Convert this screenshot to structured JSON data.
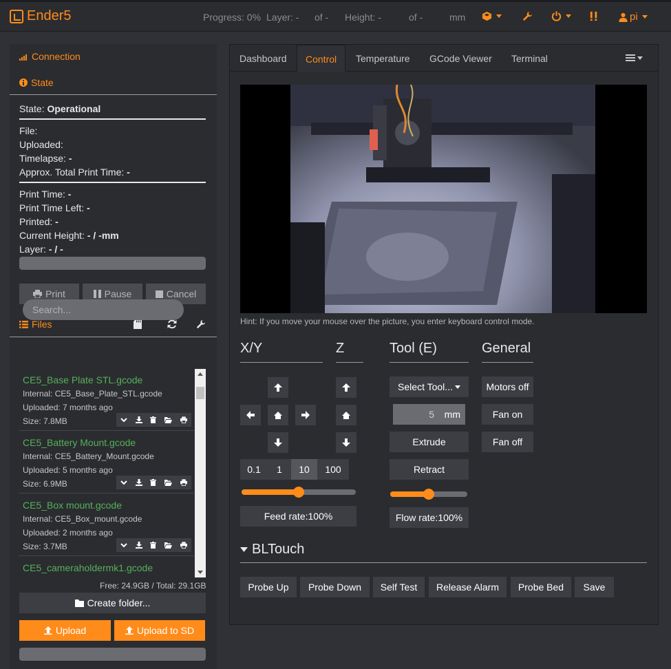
{
  "app": {
    "title": "Ender5",
    "progress": "Progress: 0%",
    "layer_label": "Layer: -",
    "layer_of": "of -",
    "height_label": "Height: -",
    "height_of": "of -",
    "height_unit": "mm",
    "user": "pi"
  },
  "colors": {
    "accent": "#ff8c1a",
    "file_name": "#54b15a",
    "panel": "#2b2c30",
    "background": "#2f3136"
  },
  "sidebar": {
    "connection": "Connection",
    "state": "State",
    "state_label": "State:",
    "state_value": "Operational",
    "file_label": "File:",
    "uploaded_label": "Uploaded:",
    "timelapse_label": "Timelapse:",
    "timelapse_value": "-",
    "approx_label": "Approx. Total Print Time:",
    "approx_value": "-",
    "print_time_label": "Print Time:",
    "print_time_value": "-",
    "print_left_label": "Print Time Left:",
    "print_left_value": "-",
    "printed_label": "Printed:",
    "printed_value": "-",
    "height_label": "Current Height:",
    "height_value": "- / -mm",
    "layer_label": "Layer:",
    "layer_value": "- / -",
    "print_button": "Print",
    "pause_button": "Pause",
    "cancel_button": "Cancel",
    "files": "Files",
    "search_placeholder": "Search...",
    "file_items": [
      {
        "name": "CE5_Base Plate STL.gcode",
        "internal": "Internal: CE5_Base_Plate_STL.gcode",
        "uploaded": "Uploaded: 7 months ago",
        "size": "Size: 7.8MB"
      },
      {
        "name": "CE5_Battery Mount.gcode",
        "internal": "Internal: CE5_Battery_Mount.gcode",
        "uploaded": "Uploaded: 5 months ago",
        "size": "Size: 6.9MB"
      },
      {
        "name": "CE5_Box mount.gcode",
        "internal": "Internal: CE5_Box_mount.gcode",
        "uploaded": "Uploaded: 2 months ago",
        "size": "Size: 3.7MB"
      },
      {
        "name": "CE5_cameraholdermk1.gcode"
      }
    ],
    "free_space": "Free: 24.9GB / Total: 29.1GB",
    "create_folder": "Create folder...",
    "upload": "Upload",
    "upload_sd": "Upload to SD"
  },
  "tabs": [
    "Dashboard",
    "Control",
    "Temperature",
    "GCode Viewer",
    "Terminal"
  ],
  "control": {
    "hint": "Hint: If you move your mouse over the picture, you enter keyboard control mode.",
    "xy": "X/Y",
    "z": "Z",
    "tool": "Tool (E)",
    "general": "General",
    "steps": [
      "0.1",
      "1",
      "10",
      "100"
    ],
    "selected_step": "10",
    "feed_rate": "Feed rate:100%",
    "feed_rate_pct": 100,
    "select_tool": "Select Tool...",
    "extrude_amount": "5",
    "extrude_unit": "mm",
    "extrude": "Extrude",
    "retract": "Retract",
    "flow_rate": "Flow rate:100%",
    "flow_rate_pct": 100,
    "motors_off": "Motors off",
    "fan_on": "Fan on",
    "fan_off": "Fan off",
    "bltouch": "BLTouch",
    "bltouch_buttons": [
      "Probe Up",
      "Probe Down",
      "Self Test",
      "Release Alarm",
      "Probe Bed",
      "Save"
    ]
  }
}
